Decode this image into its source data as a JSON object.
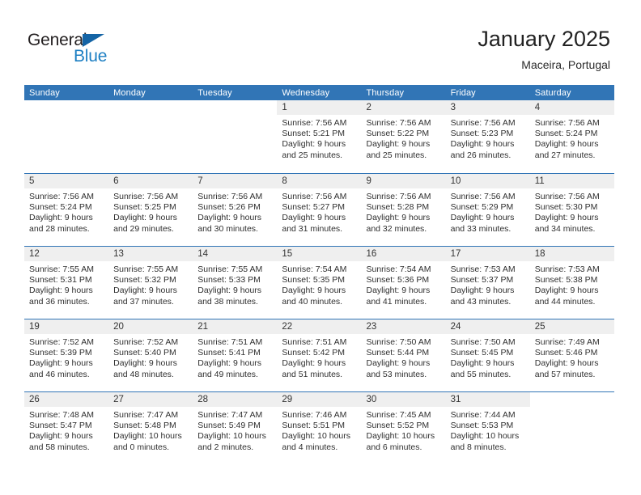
{
  "brand": {
    "name_top": "General",
    "name_bottom": "Blue",
    "triangle_color": "#1464a5",
    "blue_color": "#1d7fc3"
  },
  "header": {
    "title": "January 2025",
    "subtitle": "Maceira, Portugal"
  },
  "theme": {
    "header_blue": "#3175b6",
    "date_band_gray": "#efefef",
    "text_color": "#2f2f2f"
  },
  "weekdays": [
    "Sunday",
    "Monday",
    "Tuesday",
    "Wednesday",
    "Thursday",
    "Friday",
    "Saturday"
  ],
  "weeks": [
    [
      {
        "day": "",
        "blank": true,
        "sunrise": "",
        "sunset": "",
        "daylight_1": "",
        "daylight_2": ""
      },
      {
        "day": "",
        "blank": true,
        "sunrise": "",
        "sunset": "",
        "daylight_1": "",
        "daylight_2": ""
      },
      {
        "day": "",
        "blank": true,
        "sunrise": "",
        "sunset": "",
        "daylight_1": "",
        "daylight_2": ""
      },
      {
        "day": "1",
        "sunrise": "Sunrise: 7:56 AM",
        "sunset": "Sunset: 5:21 PM",
        "daylight_1": "Daylight: 9 hours",
        "daylight_2": "and 25 minutes."
      },
      {
        "day": "2",
        "sunrise": "Sunrise: 7:56 AM",
        "sunset": "Sunset: 5:22 PM",
        "daylight_1": "Daylight: 9 hours",
        "daylight_2": "and 25 minutes."
      },
      {
        "day": "3",
        "sunrise": "Sunrise: 7:56 AM",
        "sunset": "Sunset: 5:23 PM",
        "daylight_1": "Daylight: 9 hours",
        "daylight_2": "and 26 minutes."
      },
      {
        "day": "4",
        "sunrise": "Sunrise: 7:56 AM",
        "sunset": "Sunset: 5:24 PM",
        "daylight_1": "Daylight: 9 hours",
        "daylight_2": "and 27 minutes."
      }
    ],
    [
      {
        "day": "5",
        "sunrise": "Sunrise: 7:56 AM",
        "sunset": "Sunset: 5:24 PM",
        "daylight_1": "Daylight: 9 hours",
        "daylight_2": "and 28 minutes."
      },
      {
        "day": "6",
        "sunrise": "Sunrise: 7:56 AM",
        "sunset": "Sunset: 5:25 PM",
        "daylight_1": "Daylight: 9 hours",
        "daylight_2": "and 29 minutes."
      },
      {
        "day": "7",
        "sunrise": "Sunrise: 7:56 AM",
        "sunset": "Sunset: 5:26 PM",
        "daylight_1": "Daylight: 9 hours",
        "daylight_2": "and 30 minutes."
      },
      {
        "day": "8",
        "sunrise": "Sunrise: 7:56 AM",
        "sunset": "Sunset: 5:27 PM",
        "daylight_1": "Daylight: 9 hours",
        "daylight_2": "and 31 minutes."
      },
      {
        "day": "9",
        "sunrise": "Sunrise: 7:56 AM",
        "sunset": "Sunset: 5:28 PM",
        "daylight_1": "Daylight: 9 hours",
        "daylight_2": "and 32 minutes."
      },
      {
        "day": "10",
        "sunrise": "Sunrise: 7:56 AM",
        "sunset": "Sunset: 5:29 PM",
        "daylight_1": "Daylight: 9 hours",
        "daylight_2": "and 33 minutes."
      },
      {
        "day": "11",
        "sunrise": "Sunrise: 7:56 AM",
        "sunset": "Sunset: 5:30 PM",
        "daylight_1": "Daylight: 9 hours",
        "daylight_2": "and 34 minutes."
      }
    ],
    [
      {
        "day": "12",
        "sunrise": "Sunrise: 7:55 AM",
        "sunset": "Sunset: 5:31 PM",
        "daylight_1": "Daylight: 9 hours",
        "daylight_2": "and 36 minutes."
      },
      {
        "day": "13",
        "sunrise": "Sunrise: 7:55 AM",
        "sunset": "Sunset: 5:32 PM",
        "daylight_1": "Daylight: 9 hours",
        "daylight_2": "and 37 minutes."
      },
      {
        "day": "14",
        "sunrise": "Sunrise: 7:55 AM",
        "sunset": "Sunset: 5:33 PM",
        "daylight_1": "Daylight: 9 hours",
        "daylight_2": "and 38 minutes."
      },
      {
        "day": "15",
        "sunrise": "Sunrise: 7:54 AM",
        "sunset": "Sunset: 5:35 PM",
        "daylight_1": "Daylight: 9 hours",
        "daylight_2": "and 40 minutes."
      },
      {
        "day": "16",
        "sunrise": "Sunrise: 7:54 AM",
        "sunset": "Sunset: 5:36 PM",
        "daylight_1": "Daylight: 9 hours",
        "daylight_2": "and 41 minutes."
      },
      {
        "day": "17",
        "sunrise": "Sunrise: 7:53 AM",
        "sunset": "Sunset: 5:37 PM",
        "daylight_1": "Daylight: 9 hours",
        "daylight_2": "and 43 minutes."
      },
      {
        "day": "18",
        "sunrise": "Sunrise: 7:53 AM",
        "sunset": "Sunset: 5:38 PM",
        "daylight_1": "Daylight: 9 hours",
        "daylight_2": "and 44 minutes."
      }
    ],
    [
      {
        "day": "19",
        "sunrise": "Sunrise: 7:52 AM",
        "sunset": "Sunset: 5:39 PM",
        "daylight_1": "Daylight: 9 hours",
        "daylight_2": "and 46 minutes."
      },
      {
        "day": "20",
        "sunrise": "Sunrise: 7:52 AM",
        "sunset": "Sunset: 5:40 PM",
        "daylight_1": "Daylight: 9 hours",
        "daylight_2": "and 48 minutes."
      },
      {
        "day": "21",
        "sunrise": "Sunrise: 7:51 AM",
        "sunset": "Sunset: 5:41 PM",
        "daylight_1": "Daylight: 9 hours",
        "daylight_2": "and 49 minutes."
      },
      {
        "day": "22",
        "sunrise": "Sunrise: 7:51 AM",
        "sunset": "Sunset: 5:42 PM",
        "daylight_1": "Daylight: 9 hours",
        "daylight_2": "and 51 minutes."
      },
      {
        "day": "23",
        "sunrise": "Sunrise: 7:50 AM",
        "sunset": "Sunset: 5:44 PM",
        "daylight_1": "Daylight: 9 hours",
        "daylight_2": "and 53 minutes."
      },
      {
        "day": "24",
        "sunrise": "Sunrise: 7:50 AM",
        "sunset": "Sunset: 5:45 PM",
        "daylight_1": "Daylight: 9 hours",
        "daylight_2": "and 55 minutes."
      },
      {
        "day": "25",
        "sunrise": "Sunrise: 7:49 AM",
        "sunset": "Sunset: 5:46 PM",
        "daylight_1": "Daylight: 9 hours",
        "daylight_2": "and 57 minutes."
      }
    ],
    [
      {
        "day": "26",
        "sunrise": "Sunrise: 7:48 AM",
        "sunset": "Sunset: 5:47 PM",
        "daylight_1": "Daylight: 9 hours",
        "daylight_2": "and 58 minutes."
      },
      {
        "day": "27",
        "sunrise": "Sunrise: 7:47 AM",
        "sunset": "Sunset: 5:48 PM",
        "daylight_1": "Daylight: 10 hours",
        "daylight_2": "and 0 minutes."
      },
      {
        "day": "28",
        "sunrise": "Sunrise: 7:47 AM",
        "sunset": "Sunset: 5:49 PM",
        "daylight_1": "Daylight: 10 hours",
        "daylight_2": "and 2 minutes."
      },
      {
        "day": "29",
        "sunrise": "Sunrise: 7:46 AM",
        "sunset": "Sunset: 5:51 PM",
        "daylight_1": "Daylight: 10 hours",
        "daylight_2": "and 4 minutes."
      },
      {
        "day": "30",
        "sunrise": "Sunrise: 7:45 AM",
        "sunset": "Sunset: 5:52 PM",
        "daylight_1": "Daylight: 10 hours",
        "daylight_2": "and 6 minutes."
      },
      {
        "day": "31",
        "sunrise": "Sunrise: 7:44 AM",
        "sunset": "Sunset: 5:53 PM",
        "daylight_1": "Daylight: 10 hours",
        "daylight_2": "and 8 minutes."
      },
      {
        "day": "",
        "blank": true,
        "sunrise": "",
        "sunset": "",
        "daylight_1": "",
        "daylight_2": ""
      }
    ]
  ]
}
